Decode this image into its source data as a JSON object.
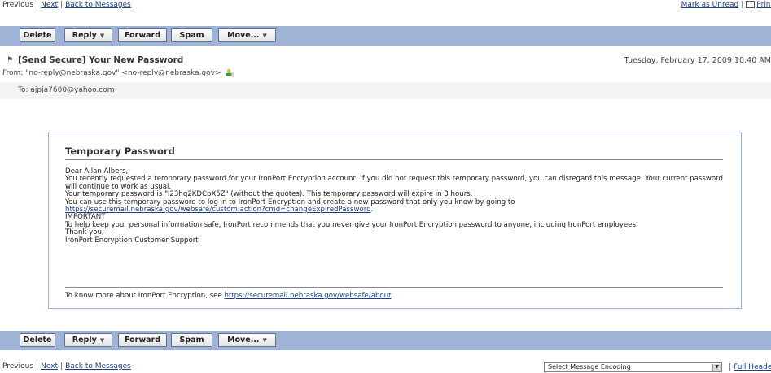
{
  "top_nav": {
    "previous": "Previous",
    "next": "Next",
    "back": "Back to Messages",
    "mark_unread": "Mark as Unread",
    "print": "Print"
  },
  "toolbar": {
    "delete": "Delete",
    "reply": "Reply",
    "forward": "Forward",
    "spam": "Spam",
    "move": "Move..."
  },
  "message_header": {
    "subject": "[Send Secure] Your New Password",
    "date": "Tuesday, February 17, 2009 10:40 AM",
    "from_label": "From:",
    "from_value": "\"no-reply@nebraska.gov\" <no-reply@nebraska.gov>",
    "to_label": "To:",
    "to_value": "ajpja7600@yahoo.com"
  },
  "message_body": {
    "title": "Temporary Password",
    "greeting": "Dear Allan Albers,",
    "para1": "You recently requested a temporary password for your IronPort Encryption account. If you did not request this temporary password, you can disregard this message. Your current password will continue to work as usual.",
    "para2": "Your temporary password is \"l23hq2KDCpX5Z\" (without the quotes). This temporary password will expire in 3 hours.",
    "para3": "You can use this temporary password to log in to IronPort Encryption and create a new password that only you know by going to",
    "link1": "https://securemail.nebraska.gov/websafe/custom.action?cmd=changeExpiredPassword",
    "link1_suffix": ".",
    "important": "IMPORTANT",
    "para4": "To help keep your personal information safe, IronPort recommends that you never give your IronPort Encryption password to anyone, including IronPort employees.",
    "thanks": "Thank you,",
    "signature": "IronPort Encryption Customer Support",
    "footer_text": "To know more about IronPort Encryption, see",
    "footer_link": "https://securemail.nebraska.gov/websafe/about"
  },
  "bottom": {
    "encoding_select": "Select Message Encoding",
    "full_headers": "Full Headers"
  },
  "colors": {
    "toolbar_bg": "#9fb3d6",
    "link": "#1a3f8a",
    "box_border": "#9fb3d6"
  }
}
